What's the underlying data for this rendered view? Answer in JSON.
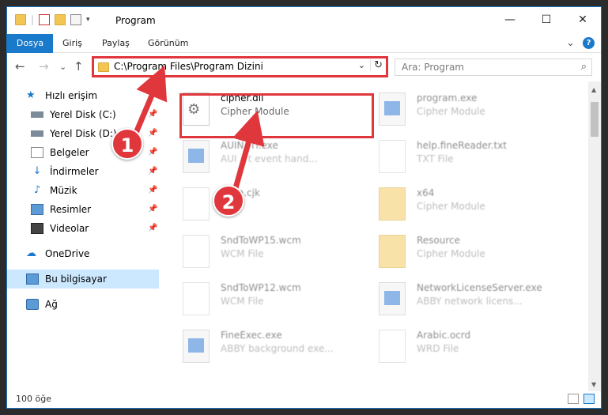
{
  "window": {
    "title": "Program",
    "controls": {
      "minimize": "—",
      "maximize": "☐",
      "close": "✕"
    }
  },
  "ribbon": {
    "tabs": [
      "Dosya",
      "Giriş",
      "Paylaş",
      "Görünüm"
    ],
    "expand": "⌄",
    "help": "?"
  },
  "nav": {
    "back": "←",
    "forward": "→",
    "recent": "⌄",
    "up": "↑",
    "address": "C:\\Program Files\\Program Dizini",
    "address_dropdown": "⌄",
    "refresh": "↻",
    "search_placeholder": "Ara: Program",
    "search_icon": "⌕"
  },
  "sidebar": {
    "quick_access": "Hızlı erişim",
    "items": [
      {
        "label": "Yerel Disk (C:)",
        "icon": "drive-icon",
        "pinned": true
      },
      {
        "label": "Yerel Disk (D:)",
        "icon": "drive-icon",
        "pinned": true
      },
      {
        "label": "Belgeler",
        "icon": "documents-icon",
        "pinned": true
      },
      {
        "label": "İndirmeler",
        "icon": "download-icon",
        "pinned": true
      },
      {
        "label": "Müzik",
        "icon": "music-icon",
        "pinned": true
      },
      {
        "label": "Resimler",
        "icon": "pictures-icon",
        "pinned": true
      },
      {
        "label": "Videolar",
        "icon": "video-icon",
        "pinned": true
      }
    ],
    "onedrive": "OneDrive",
    "this_pc": "Bu bilgisayar",
    "network": "Ağ"
  },
  "files": [
    {
      "name": "cipher.dll",
      "type": "Cipher Module",
      "kind": "dll",
      "faded": false
    },
    {
      "name": "program.exe",
      "type": "Cipher Module",
      "kind": "exe",
      "faded": true
    },
    {
      "name": "AUINSTl.exe",
      "type": "AUI kit event hand...",
      "kind": "exe",
      "faded": true
    },
    {
      "name": "help.fineReader.txt",
      "type": "TXT File",
      "kind": "doc",
      "faded": true
    },
    {
      "name": "chen.cjk",
      "type": "File",
      "kind": "doc",
      "faded": true
    },
    {
      "name": "x64",
      "type": "Cipher Module",
      "kind": "folder",
      "faded": true
    },
    {
      "name": "SndToWP15.wcm",
      "type": "WCM File",
      "kind": "doc",
      "faded": true
    },
    {
      "name": "Resource",
      "type": "Cipher Module",
      "kind": "folder",
      "faded": true
    },
    {
      "name": "SndToWP12.wcm",
      "type": "WCM File",
      "kind": "doc",
      "faded": true
    },
    {
      "name": "NetworkLicenseServer.exe",
      "type": "ABBY network licens...",
      "kind": "exe",
      "faded": true
    },
    {
      "name": "FineExec.exe",
      "type": "ABBY background exe...",
      "kind": "exe",
      "faded": true
    },
    {
      "name": "Arabic.ocrd",
      "type": "WRD File",
      "kind": "doc",
      "faded": true
    }
  ],
  "status": {
    "count": "100 öğe"
  },
  "callouts": [
    "1",
    "2"
  ],
  "colors": {
    "accent": "#1979ca",
    "highlight": "#e0373d"
  }
}
